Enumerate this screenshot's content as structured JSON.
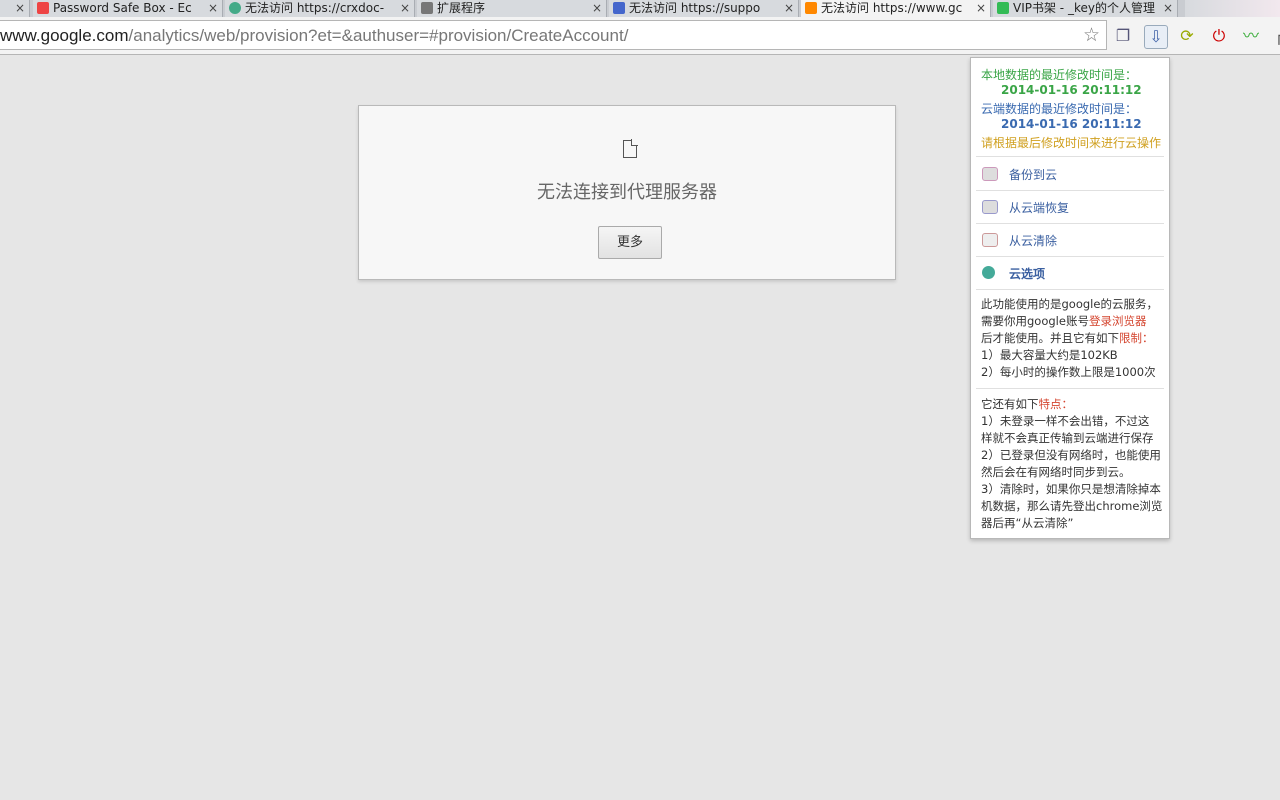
{
  "tabs": [
    {
      "title": "Password Safe Box - Ec",
      "close": "×",
      "favicon_color": "#e44"
    },
    {
      "title": "无法访问 https://crxdoc-",
      "close": "×",
      "favicon_color": "#4a8"
    },
    {
      "title": "扩展程序",
      "close": "×",
      "favicon_color": "#777"
    },
    {
      "title": "无法访问 https://suppo",
      "close": "×",
      "favicon_color": "#46c"
    },
    {
      "title": "无法访问 https://www.gc",
      "close": "×",
      "favicon_color": "#f80"
    },
    {
      "title": "VIP书架 - _key的个人管理",
      "close": "×",
      "favicon_color": "#3b5"
    }
  ],
  "omnibox": {
    "url_host": "www.google.com",
    "url_path": "/analytics/web/provision?et=&authuser=#provision/CreateAccount/"
  },
  "error": {
    "title": "无法连接到代理服务器",
    "more_button": "更多"
  },
  "popup": {
    "local_label": "本地数据的最近修改时间是：",
    "local_time": "2014-01-16 20:11:12",
    "cloud_label": "云端数据的最近修改时间是：",
    "cloud_time": "2014-01-16 20:11:12",
    "hint": "请根据最后修改时间来进行云操作",
    "items": [
      {
        "label": "备份到云"
      },
      {
        "label": "从云端恢复"
      },
      {
        "label": "从云清除"
      },
      {
        "label": "云选项"
      }
    ],
    "desc1_a": "此功能使用的是google的云服务，",
    "desc1_b": "需要你用google账号",
    "desc1_b_link": "登录浏览器",
    "desc1_c": "后才能使用。并且它有如下",
    "desc1_c_red": "限制：",
    "desc1_d": "1）最大容量大约是102KB",
    "desc1_e": "2）每小时的操作数上限是1000次",
    "desc2_a": "它还有如下",
    "desc2_a_red": "特点：",
    "desc2_b": "1）未登录一样不会出错，不过这",
    "desc2_c": "样就不会真正传输到云端进行保存",
    "desc2_d": "2）已登录但没有网络时，也能使用",
    "desc2_e": "然后会在有网络时同步到云。",
    "desc2_f": "3）清除时，如果你只是想清除掉本",
    "desc2_g": "机数据，那么请先登出chrome浏览",
    "desc2_h": "器后再“从云清除”"
  }
}
